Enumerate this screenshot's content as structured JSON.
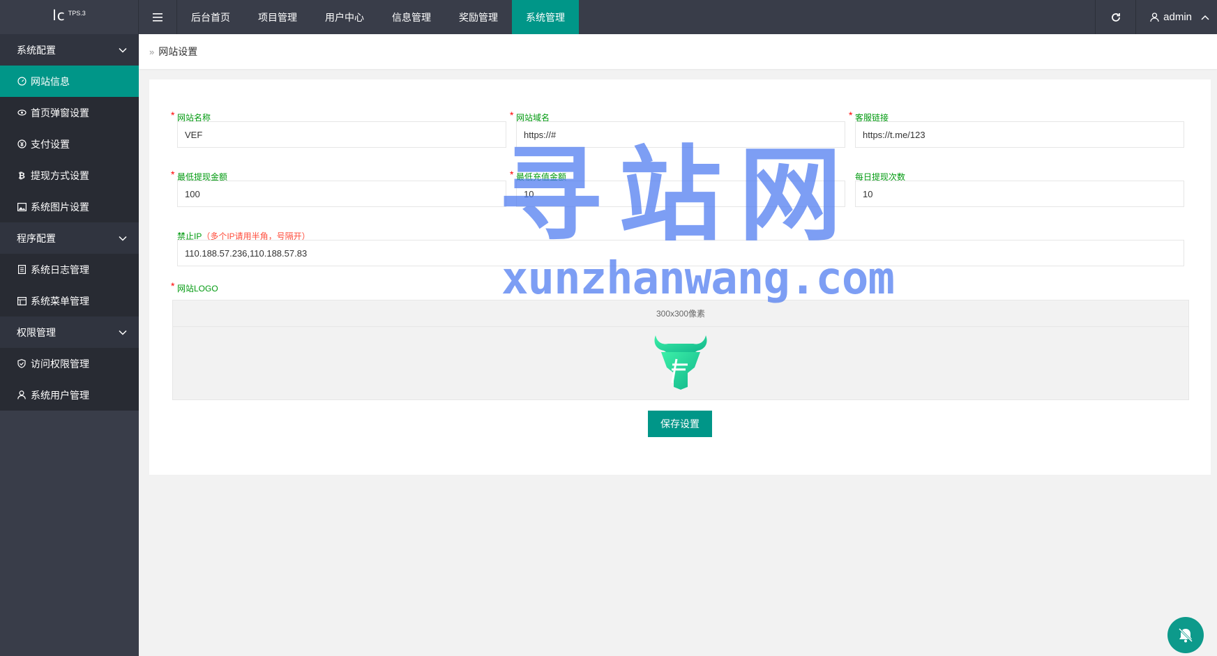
{
  "app": {
    "logo_text": "lc",
    "logo_version": "TPS.3"
  },
  "topnav": {
    "items": [
      "后台首页",
      "项目管理",
      "用户中心",
      "信息管理",
      "奖励管理",
      "系统管理"
    ],
    "active": "系统管理",
    "user": "admin"
  },
  "sidebar": {
    "groups": [
      {
        "label": "系统配置",
        "items": [
          {
            "label": "网站信息",
            "icon": "dashboard-icon",
            "active": true
          },
          {
            "label": "首页弹窗设置",
            "icon": "eye-icon"
          },
          {
            "label": "支付设置",
            "icon": "yen-icon"
          },
          {
            "label": "提现方式设置",
            "icon": "bitcoin-icon"
          },
          {
            "label": "系统图片设置",
            "icon": "image-icon"
          }
        ]
      },
      {
        "label": "程序配置",
        "items": [
          {
            "label": "系统日志管理",
            "icon": "log-icon"
          },
          {
            "label": "系统菜单管理",
            "icon": "menu-table-icon"
          }
        ]
      },
      {
        "label": "权限管理",
        "items": [
          {
            "label": "访问权限管理",
            "icon": "shield-check-icon"
          },
          {
            "label": "系统用户管理",
            "icon": "user-icon"
          }
        ]
      }
    ]
  },
  "breadcrumb": {
    "current": "网站设置"
  },
  "form": {
    "site_name": {
      "label": "网站名称",
      "value": "VEF",
      "required": true
    },
    "site_domain": {
      "label": "网站域名",
      "value": "https://#",
      "required": true
    },
    "service_link": {
      "label": "客服链接",
      "value": "https://t.me/123",
      "required": true
    },
    "min_withdraw": {
      "label": "最低提现金额",
      "value": "100",
      "required": true
    },
    "min_recharge": {
      "label": "最低充值金额",
      "value": "10",
      "required": true
    },
    "daily_withdraw": {
      "label": "每日提现次数",
      "value": "10",
      "required": false
    },
    "ban_ip": {
      "label": "禁止IP",
      "hint": "（多个IP请用半角，号隔开）",
      "value": "110.188.57.236,110.188.57.83"
    },
    "site_logo": {
      "label": "网站LOGO",
      "size_hint": "300x300像素",
      "required": true
    },
    "save_label": "保存设置"
  },
  "watermark": {
    "cn": "寻站网",
    "en": "xunzhanwang.com"
  },
  "colors": {
    "accent": "#009688",
    "topbar": "#393d49",
    "label": "#009a0f",
    "required": "#ff0000"
  }
}
